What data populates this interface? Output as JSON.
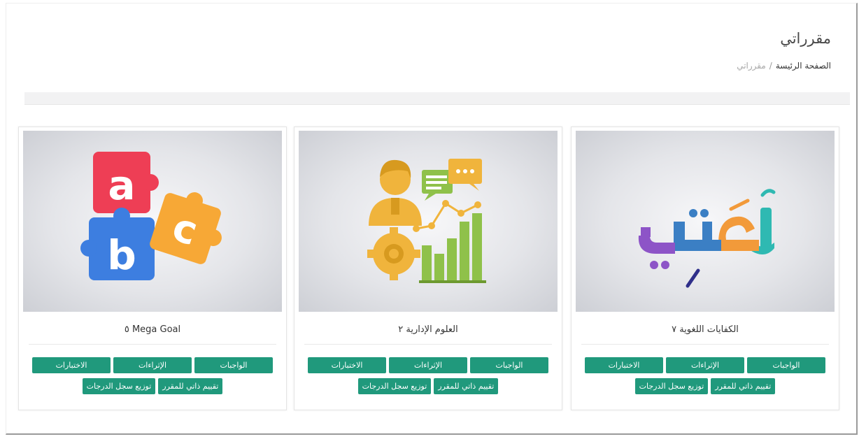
{
  "header": {
    "title": "مقرراتي",
    "breadcrumb": {
      "home": "الصفحة الرئيسة",
      "separator": "/",
      "current": "مقرراتي"
    }
  },
  "colors": {
    "button": "#20997c",
    "background": "#ffffff",
    "band": "#f2f2f3"
  },
  "courses": [
    {
      "title": "الكفايات اللغوية ٧",
      "image_icon": "lughati-logo",
      "logo_text": "لُغَتِي",
      "buttons": [
        "الواجبات",
        "الإثراءات",
        "الاختبارات",
        "تقييم ذاتي للمقرر",
        "توزيع سجل الدرجات"
      ]
    },
    {
      "title": "العلوم الإدارية ٢",
      "image_icon": "management-science-icon",
      "buttons": [
        "الواجبات",
        "الإثراءات",
        "الاختبارات",
        "تقييم ذاتي للمقرر",
        "توزيع سجل الدرجات"
      ]
    },
    {
      "title": "Mega Goal ٥",
      "image_icon": "abc-puzzle-icon",
      "logo_letters": [
        "a",
        "b",
        "c"
      ],
      "buttons": [
        "الواجبات",
        "الإثراءات",
        "الاختبارات",
        "تقييم ذاتي للمقرر",
        "توزيع سجل الدرجات"
      ]
    }
  ]
}
